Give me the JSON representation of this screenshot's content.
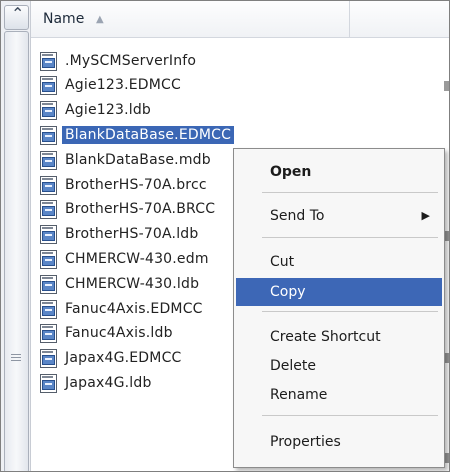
{
  "header": {
    "name_label": "Name"
  },
  "files": [
    {
      "name": ".MySCMServerInfo",
      "selected": false
    },
    {
      "name": "Agie123.EDMCC",
      "selected": false
    },
    {
      "name": "Agie123.ldb",
      "selected": false
    },
    {
      "name": "BlankDataBase.EDMCC",
      "selected": true
    },
    {
      "name": "BlankDataBase.mdb",
      "selected": false
    },
    {
      "name": "BrotherHS-70A.brcc",
      "selected": false
    },
    {
      "name": "BrotherHS-70A.BRCC",
      "selected": false
    },
    {
      "name": "BrotherHS-70A.ldb",
      "selected": false
    },
    {
      "name": "CHMERCW-430.edm",
      "selected": false
    },
    {
      "name": "CHMERCW-430.ldb",
      "selected": false
    },
    {
      "name": "Fanuc4Axis.EDMCC",
      "selected": false
    },
    {
      "name": "Fanuc4Axis.ldb",
      "selected": false
    },
    {
      "name": "Japax4G.EDMCC",
      "selected": false
    },
    {
      "name": "Japax4G.ldb",
      "selected": false
    }
  ],
  "context_menu": {
    "open": "Open",
    "send_to": "Send To",
    "cut": "Cut",
    "copy": "Copy",
    "create_shortcut": "Create Shortcut",
    "delete": "Delete",
    "rename": "Rename",
    "properties": "Properties"
  },
  "colors": {
    "selection": "#3b67b5",
    "menu_highlight": "#3d67b6"
  }
}
